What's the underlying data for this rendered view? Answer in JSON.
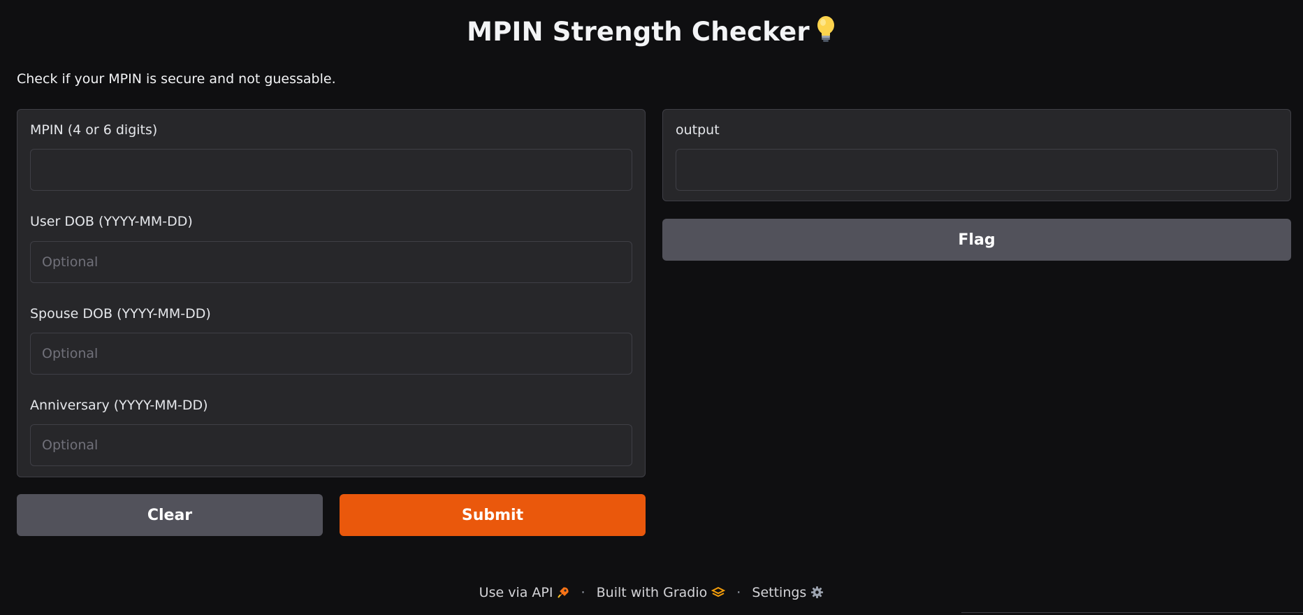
{
  "header": {
    "title": "MPIN Strength Checker",
    "title_icon": "lightbulb-icon",
    "description": "Check if your MPIN is secure and not guessable."
  },
  "inputs": {
    "mpin": {
      "label": "MPIN (4 or 6 digits)",
      "value": "",
      "placeholder": ""
    },
    "user_dob": {
      "label": "User DOB (YYYY-MM-DD)",
      "value": "",
      "placeholder": "Optional"
    },
    "spouse_dob": {
      "label": "Spouse DOB (YYYY-MM-DD)",
      "value": "",
      "placeholder": "Optional"
    },
    "anniversary": {
      "label": "Anniversary (YYYY-MM-DD)",
      "value": "",
      "placeholder": "Optional"
    }
  },
  "buttons": {
    "clear": "Clear",
    "submit": "Submit",
    "flag": "Flag"
  },
  "output": {
    "label": "output",
    "value": ""
  },
  "footer": {
    "api_label": "Use via API",
    "api_icon": "rocket-icon",
    "built_label": "Built with Gradio",
    "built_icon": "gradio-logo-icon",
    "settings_label": "Settings",
    "settings_icon": "gear-icon",
    "separator": "·"
  },
  "colors": {
    "background": "#0f0f11",
    "panel": "#27272a",
    "border": "#3f3f46",
    "primary": "#ea580c",
    "secondary": "#52525b"
  }
}
